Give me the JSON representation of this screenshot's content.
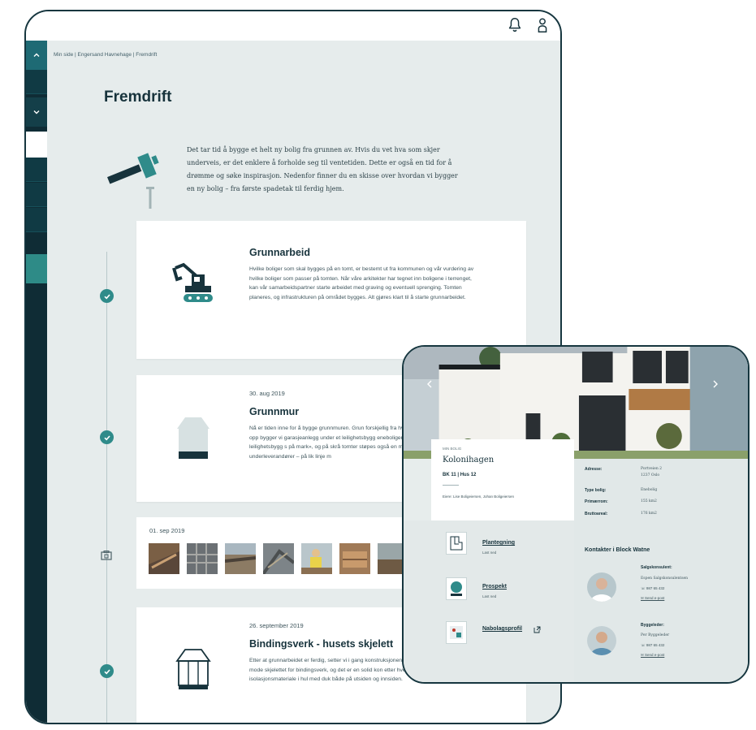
{
  "app": {
    "breadcrumb": "Min side  |  Engersand Havnehage  |  Fremdrift",
    "page_title": "Fremdrift",
    "intro": "Det tar tid å bygge et helt ny bolig fra grunnen av. Hvis du vet hva som skjer underveis, er det enklere å forholde seg til ventetiden. Dette er også en tid for å drømme og søke inspirasjon. Nedenfor finner du en skisse over hvordan vi bygger en ny bolig – fra første spadetak til ferdig hjem."
  },
  "icons": {
    "bell": "bell-icon",
    "user": "user-icon",
    "chevron_up": "chevron-up-icon",
    "chevron_down": "chevron-down-icon"
  },
  "steps": [
    {
      "title": "Grunnarbeid",
      "date": "",
      "body": "Hvilke boliger som skal bygges på en tomt, er bestemt ut fra kommunen og vår vurdering av hvilke boliger som passer på tomten. Når våre arkitekter har tegnet inn boligene i terrenget, kan vår samarbeidspartner starte arbeidet med graving og eventuell sprenging.  Tomten planeres, og infrastrukturen på området bygges. Alt gjøres klart til å starte grunnarbeidet."
    },
    {
      "title": "Grunnmur",
      "date": "30. aug 2019",
      "body": "Nå er tiden inne for å bygge grunnmuren. Grun forskjellig fra hvilken type bygg vi skal sette opp bygger vi garasjeanlegg under et leilighetsbygg eneboliger, rekkehus og mindre leilighetsbygg s på mark», og på skrå tomter støpes også en mu gjort av lokale underleverandører – på lik linje m"
    },
    {
      "title": "Bindingsverk - husets skjelett",
      "date": "26. september 2019",
      "body": "Etter at grunnarbeidet er ferdig, setter vi i gang konstruksjonene for vegger, gulv og tak. I mode skjelettet for bindingsverk, og det er en solid kon etter hvert skal fylles med  isolasjonsmateriale i hul med duk både på utsiden og innsiden."
    }
  ],
  "gallery": {
    "date": "01. sep 2019"
  },
  "overlay": {
    "kicker": "MIN BOLIG",
    "name": "Kolonihagen",
    "unit": "BK 11 | Hus 12",
    "owners": "Eiere: Lise Boligeiersen, Johan Boligeiersen",
    "info": [
      {
        "key": "Adresse:",
        "value": "Portveien 2"
      },
      {
        "key": "",
        "value": "1237 Oslo"
      },
      {
        "key": "Type bolig:",
        "value": "Enebolig"
      },
      {
        "key": "Primærrom:",
        "value": "155 km2"
      },
      {
        "key": "Bruttoareal:",
        "value": "176 km2"
      }
    ],
    "documents": [
      {
        "label": "Plantegning",
        "sub": "Last ned"
      },
      {
        "label": "Prospekt",
        "sub": "Last ned"
      },
      {
        "label": "Nabolagsprofil",
        "sub": ""
      }
    ],
    "contacts_title": "Kontakter i Block Watne",
    "contacts": [
      {
        "role": "Salgskonsulent:",
        "name": "Espen Salgskonsulentsen",
        "phone": "987 65 432",
        "mail": "Send e-post"
      },
      {
        "role": "Byggeleder:",
        "name": "Per Byggeleder",
        "phone": "987 65 432",
        "mail": "Send e-post"
      }
    ],
    "colors": {
      "accent": "#2f8b8a",
      "dark": "#0f2c35"
    }
  }
}
